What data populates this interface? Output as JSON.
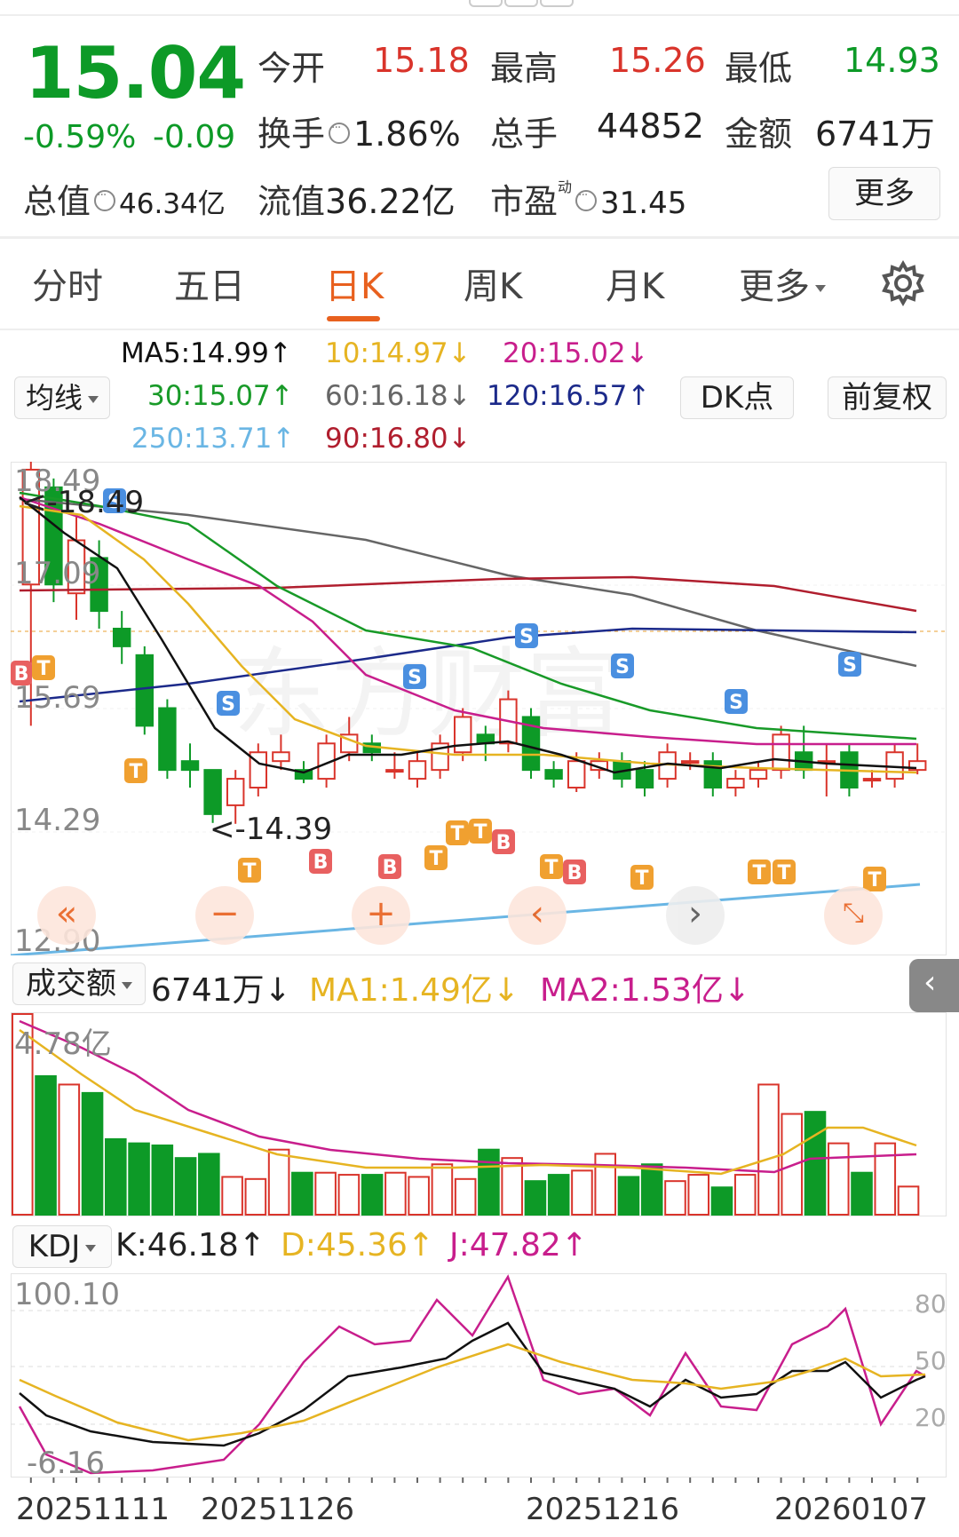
{
  "quote": {
    "price": "15.04",
    "change_pct": "-0.59%",
    "change": "-0.09",
    "open_label": "今开",
    "open": "15.18",
    "high_label": "最高",
    "high": "15.26",
    "low_label": "最低",
    "low": "14.93",
    "turnover_label": "换手",
    "turnover": "1.86%",
    "volume_label": "总手",
    "volume": "44852",
    "amount_label": "金额",
    "amount": "6741万",
    "mcap_label": "总值",
    "mcap": "46.34亿",
    "float_label": "流值",
    "float_cap": "36.22亿",
    "pe_label": "市盈",
    "pe_sup": "动",
    "pe": "31.45",
    "more_button": "更多"
  },
  "tabs": [
    {
      "label": "分时",
      "active": false
    },
    {
      "label": "五日",
      "active": false
    },
    {
      "label": "日K",
      "active": true
    },
    {
      "label": "周K",
      "active": false
    },
    {
      "label": "月K",
      "active": false
    },
    {
      "label": "更多",
      "active": false
    }
  ],
  "ma_lines": {
    "ma5": "MA5:14.99↑",
    "ma10": "10:14.97↓",
    "ma20": "20:15.02↓",
    "ma30": "30:15.07↑",
    "ma60": "60:16.18↓",
    "ma120": "120:16.57↑",
    "ma250": "250:13.71↑",
    "ma90": "90:16.80↓"
  },
  "controls": {
    "avg_select": "均线",
    "dk_button": "DK点",
    "adjust_button": "前复权"
  },
  "colors": {
    "up": "#d9342b",
    "down": "#0d9a27",
    "accent": "#e8601e",
    "ma5": "#111111",
    "ma10": "#e6b422",
    "ma20": "#c81e8c",
    "ma30": "#189a28",
    "ma60": "#666666",
    "ma120": "#1c2a8a",
    "ma250": "#6ab6e4",
    "ma90": "#b01e2e"
  },
  "main_chart": {
    "y_labels": [
      "18.49",
      "17.09",
      "15.69",
      "14.29",
      "12.90"
    ],
    "high_marker": "<-18.49",
    "low_marker": "<-14.39",
    "ylim": [
      12.9,
      18.49
    ]
  },
  "volume": {
    "select": "成交额",
    "value": "6741万↓",
    "ma1": "MA1:1.49亿↓",
    "ma2": "MA2:1.53亿↓",
    "max_label": "4.78亿"
  },
  "kdj": {
    "select": "KDJ",
    "k": "K:46.18↑",
    "d": "D:45.36↑",
    "j": "J:47.82↑",
    "top_label": "100.10",
    "bottom_label": "-6.16",
    "right_labels": [
      "80",
      "50",
      "20"
    ]
  },
  "dates": [
    "20251111",
    "20251126",
    "20251216",
    "20260107"
  ],
  "chart_data": {
    "type": "candlestick",
    "candles": [
      {
        "o": 17.1,
        "c": 18.4,
        "h": 18.49,
        "l": 15.5
      },
      {
        "o": 18.2,
        "c": 17.1,
        "h": 18.3,
        "l": 16.9
      },
      {
        "o": 17.0,
        "c": 17.6,
        "h": 17.9,
        "l": 16.7
      },
      {
        "o": 17.4,
        "c": 16.8,
        "h": 17.6,
        "l": 16.6
      },
      {
        "o": 16.6,
        "c": 16.4,
        "h": 16.8,
        "l": 16.2
      },
      {
        "o": 16.3,
        "c": 15.5,
        "h": 16.4,
        "l": 15.4
      },
      {
        "o": 15.7,
        "c": 15.0,
        "h": 15.8,
        "l": 14.9
      },
      {
        "o": 15.1,
        "c": 15.0,
        "h": 15.3,
        "l": 14.8
      },
      {
        "o": 15.0,
        "c": 14.5,
        "h": 15.0,
        "l": 14.4
      },
      {
        "o": 14.6,
        "c": 14.9,
        "h": 15.0,
        "l": 14.39
      },
      {
        "o": 14.8,
        "c": 15.2,
        "h": 15.3,
        "l": 14.7
      },
      {
        "o": 15.1,
        "c": 15.2,
        "h": 15.4,
        "l": 15.0
      },
      {
        "o": 15.0,
        "c": 14.9,
        "h": 15.1,
        "l": 14.85
      },
      {
        "o": 14.9,
        "c": 15.3,
        "h": 15.4,
        "l": 14.8
      },
      {
        "o": 15.2,
        "c": 15.4,
        "h": 15.6,
        "l": 15.1
      },
      {
        "o": 15.3,
        "c": 15.2,
        "h": 15.4,
        "l": 15.1
      },
      {
        "o": 15.0,
        "c": 15.0,
        "h": 15.2,
        "l": 14.9
      },
      {
        "o": 14.9,
        "c": 15.1,
        "h": 15.2,
        "l": 14.8
      },
      {
        "o": 15.0,
        "c": 15.3,
        "h": 15.4,
        "l": 14.9
      },
      {
        "o": 15.2,
        "c": 15.6,
        "h": 15.7,
        "l": 15.1
      },
      {
        "o": 15.4,
        "c": 15.3,
        "h": 15.5,
        "l": 15.1
      },
      {
        "o": 15.3,
        "c": 15.8,
        "h": 15.9,
        "l": 15.2
      },
      {
        "o": 15.6,
        "c": 15.0,
        "h": 15.7,
        "l": 14.9
      },
      {
        "o": 15.0,
        "c": 14.9,
        "h": 15.1,
        "l": 14.8
      },
      {
        "o": 14.8,
        "c": 15.1,
        "h": 15.2,
        "l": 14.75
      },
      {
        "o": 15.0,
        "c": 15.1,
        "h": 15.2,
        "l": 14.9
      },
      {
        "o": 15.1,
        "c": 14.9,
        "h": 15.2,
        "l": 14.8
      },
      {
        "o": 15.0,
        "c": 14.8,
        "h": 15.1,
        "l": 14.7
      },
      {
        "o": 14.9,
        "c": 15.2,
        "h": 15.3,
        "l": 14.8
      },
      {
        "o": 15.1,
        "c": 15.1,
        "h": 15.2,
        "l": 15.0
      },
      {
        "o": 15.1,
        "c": 14.8,
        "h": 15.2,
        "l": 14.7
      },
      {
        "o": 14.8,
        "c": 14.9,
        "h": 15.0,
        "l": 14.7
      },
      {
        "o": 14.9,
        "c": 15.0,
        "h": 15.1,
        "l": 14.8
      },
      {
        "o": 15.0,
        "c": 15.4,
        "h": 15.5,
        "l": 14.9
      },
      {
        "o": 15.2,
        "c": 15.0,
        "h": 15.5,
        "l": 14.9
      },
      {
        "o": 15.1,
        "c": 15.1,
        "h": 15.3,
        "l": 14.7
      },
      {
        "o": 15.2,
        "c": 14.8,
        "h": 15.3,
        "l": 14.7
      },
      {
        "o": 14.9,
        "c": 14.9,
        "h": 15.0,
        "l": 14.8
      },
      {
        "o": 14.9,
        "c": 15.2,
        "h": 15.3,
        "l": 14.8
      },
      {
        "o": 15.0,
        "c": 15.1,
        "h": 15.3,
        "l": 14.95
      }
    ],
    "volume_amounts": [
      4.78,
      3.3,
      3.1,
      2.9,
      1.8,
      1.7,
      1.65,
      1.35,
      1.45,
      0.9,
      0.85,
      1.55,
      1.0,
      1.0,
      0.95,
      0.95,
      1.0,
      0.9,
      1.2,
      0.85,
      1.55,
      1.35,
      0.8,
      0.95,
      1.05,
      1.45,
      0.9,
      1.2,
      0.8,
      0.95,
      0.65,
      0.95,
      3.1,
      2.4,
      2.45,
      1.7,
      1.0,
      1.7,
      0.67
    ]
  }
}
